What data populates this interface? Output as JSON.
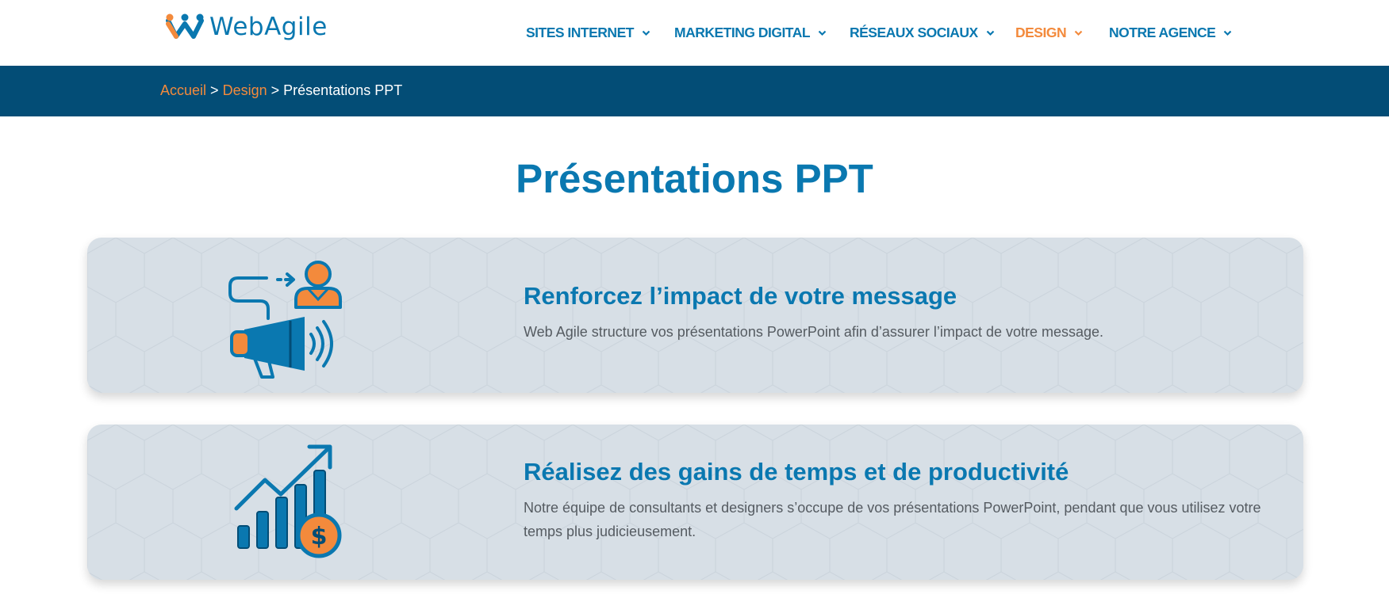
{
  "logo": {
    "text": "WebAgile"
  },
  "nav": {
    "items": [
      {
        "label": "SITES INTERNET"
      },
      {
        "label": "MARKETING DIGITAL"
      },
      {
        "label": "RÉSEAUX SOCIAUX"
      },
      {
        "label": "DESIGN",
        "active": true
      },
      {
        "label": "NOTRE AGENCE"
      }
    ]
  },
  "breadcrumb": {
    "home": "Accueil",
    "sep1": ">",
    "section": "Design",
    "sep2": ">",
    "current": "Présentations PPT"
  },
  "page": {
    "title": "Présentations PPT"
  },
  "cards": [
    {
      "icon": "megaphone-audience-icon",
      "title": "Renforcez l’impact de votre message",
      "text": "Web Agile structure vos présentations PowerPoint afin d’assurer l’impact de votre message."
    },
    {
      "icon": "growth-chart-dollar-icon",
      "title": "Réalisez des gains de temps et de productivité",
      "text": "Notre équipe de consultants et designers s’occupe de vos présentations PowerPoint, pendant que vous utilisez votre temps plus judicieusement."
    }
  ],
  "colors": {
    "primary": "#0a78b0",
    "accent": "#f38a3c",
    "bar": "#034d76",
    "card": "#d7dfe6"
  }
}
